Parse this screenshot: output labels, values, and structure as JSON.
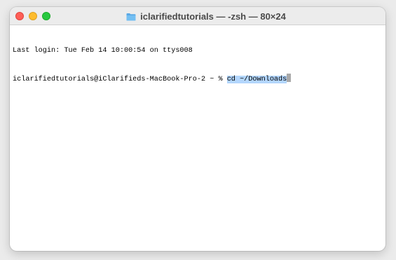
{
  "window": {
    "title": "iclarifiedtutorials — -zsh — 80×24"
  },
  "titlebar": {
    "buttons": [
      "close",
      "minimize",
      "maximize"
    ],
    "icon": "folder-icon"
  },
  "terminal": {
    "last_login": "Last login: Tue Feb 14 10:00:54 on ttys008",
    "prompt": "iclarifiedtutorials@iClarifieds-MacBook-Pro-2 ~ % ",
    "command": "cd ~/Downloads"
  },
  "colors": {
    "close": "#fe5f57",
    "minimize": "#febc2e",
    "maximize": "#28c840",
    "selection": "#b3d6fd",
    "folder": "#5aa9e6"
  }
}
